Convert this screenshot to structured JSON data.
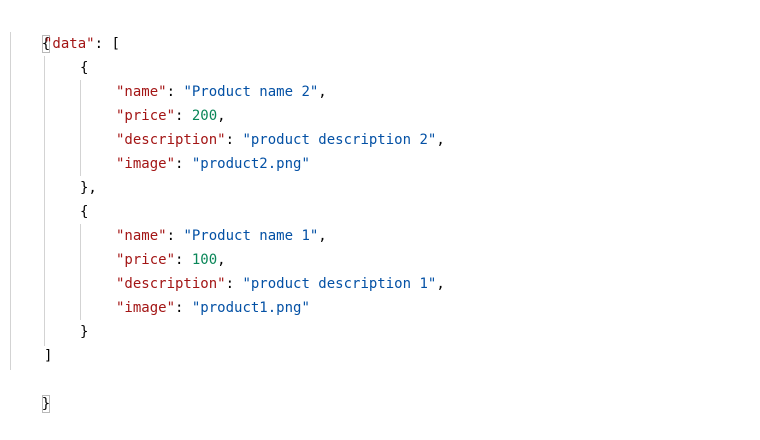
{
  "editor": {
    "colors": {
      "background": "#ffffff",
      "key": "#a31515",
      "string": "#0451a5",
      "number": "#098658",
      "punctuation": "#000000",
      "indent_guide": "#d3d3d3"
    },
    "tokens": {
      "open_brace": "{",
      "close_brace": "}",
      "open_bracket": "[",
      "close_bracket": "]",
      "colon": ": ",
      "comma": ",",
      "item_close_comma": "},"
    },
    "root": {
      "key": "\"data\"",
      "items": [
        {
          "name_key": "\"name\"",
          "name_value": "\"Product name 2\"",
          "price_key": "\"price\"",
          "price_value": "200",
          "description_key": "\"description\"",
          "description_value": "\"product description 2\"",
          "image_key": "\"image\"",
          "image_value": "\"product2.png\""
        },
        {
          "name_key": "\"name\"",
          "name_value": "\"Product name 1\"",
          "price_key": "\"price\"",
          "price_value": "100",
          "description_key": "\"description\"",
          "description_value": "\"product description 1\"",
          "image_key": "\"image\"",
          "image_value": "\"product1.png\""
        }
      ]
    }
  }
}
